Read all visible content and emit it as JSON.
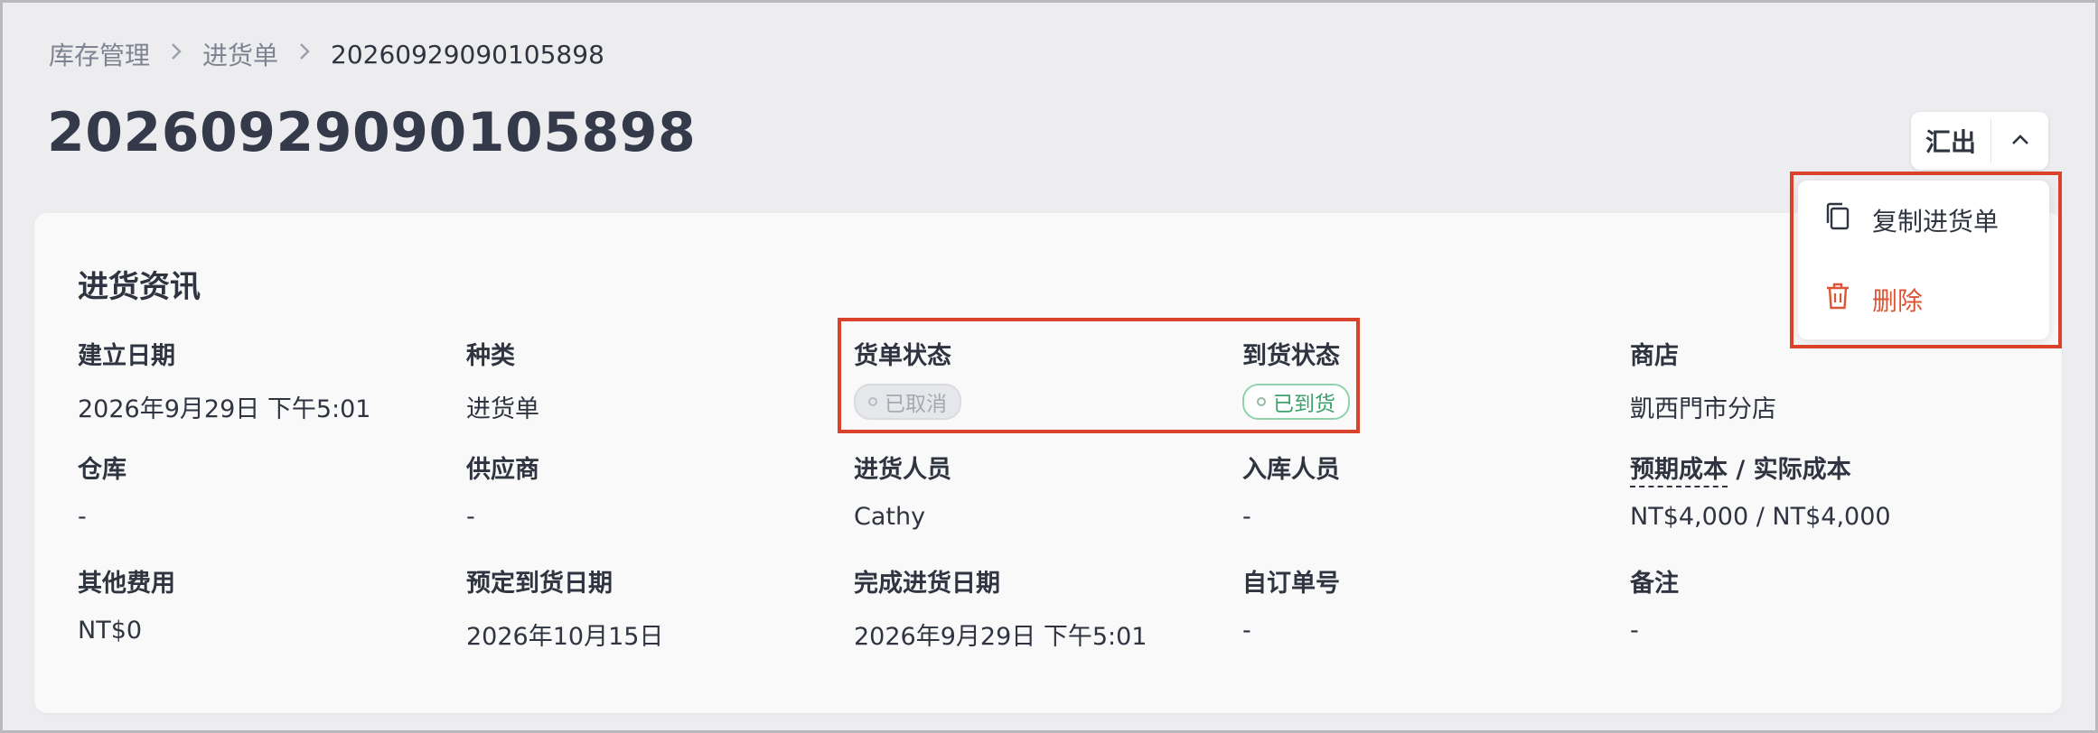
{
  "breadcrumb": {
    "items": [
      "库存管理",
      "进货单"
    ],
    "current": "20260929090105898"
  },
  "page": {
    "title": "20260929090105898"
  },
  "actions": {
    "export_label": "汇出",
    "menu": {
      "copy_label": "复制进货单",
      "delete_label": "删除"
    }
  },
  "section": {
    "title": "进货资讯",
    "fields": {
      "created_date": {
        "label": "建立日期",
        "value": "2026年9月29日 下午5:01"
      },
      "type": {
        "label": "种类",
        "value": "进货单"
      },
      "order_status": {
        "label": "货单状态",
        "value": "已取消"
      },
      "arrival_status": {
        "label": "到货状态",
        "value": "已到货"
      },
      "store": {
        "label": "商店",
        "value": "凱西門市分店"
      },
      "warehouse": {
        "label": "仓库",
        "value": "-"
      },
      "supplier": {
        "label": "供应商",
        "value": "-"
      },
      "purchaser": {
        "label": "进货人员",
        "value": "Cathy"
      },
      "receiver": {
        "label": "入库人员",
        "value": "-"
      },
      "cost": {
        "label_expected": "预期成本",
        "label_sep": " / ",
        "label_actual": "实际成本",
        "value": "NT$4,000 / NT$4,000"
      },
      "other_fees": {
        "label": "其他费用",
        "value": "NT$0"
      },
      "expected_arrival": {
        "label": "预定到货日期",
        "value": "2026年10月15日"
      },
      "completed_date": {
        "label": "完成进货日期",
        "value": "2026年9月29日 下午5:01"
      },
      "custom_order_no": {
        "label": "自订单号",
        "value": "-"
      },
      "notes": {
        "label": "备注",
        "value": "-"
      }
    }
  },
  "icons": {
    "chevron": "chevron-up-icon",
    "breadcrumb_separator": "chevron-right-icon",
    "copy": "copy-icon",
    "delete": "trash-icon"
  },
  "colors": {
    "highlight": "#d9432c",
    "delete_text": "#dc5535",
    "arrived_green": "#3ba26a",
    "cancel_gray": "#a5a9b1"
  }
}
